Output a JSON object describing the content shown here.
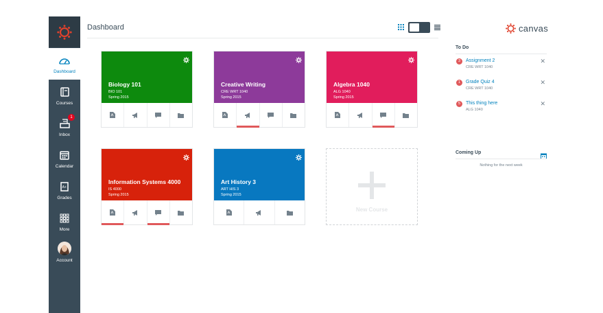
{
  "app": {
    "brand_name": "canvas",
    "accent": "#0081bd",
    "nav_bg": "#394b58"
  },
  "header": {
    "title": "Dashboard",
    "view_icons": [
      "grid-icon",
      "toggle-switch",
      "list-icon"
    ]
  },
  "global_nav": {
    "items": [
      {
        "key": "dashboard",
        "label": "Dashboard",
        "icon": "dashboard-icon",
        "active": true
      },
      {
        "key": "courses",
        "label": "Courses",
        "icon": "courses-icon"
      },
      {
        "key": "inbox",
        "label": "Inbox",
        "icon": "inbox-icon",
        "badge": "1"
      },
      {
        "key": "calendar",
        "label": "Calendar",
        "icon": "calendar-icon"
      },
      {
        "key": "grades",
        "label": "Grades",
        "icon": "grades-icon"
      },
      {
        "key": "more",
        "label": "More",
        "icon": "more-icon"
      },
      {
        "key": "account",
        "label": "Account",
        "icon": "avatar"
      }
    ]
  },
  "cards": [
    {
      "title": "Biology 101",
      "code": "BIO 101",
      "term": "Spring 2015",
      "color": "#0d8a0d"
    },
    {
      "title": "Creative Writing",
      "code": "CRE WRT 1040",
      "term": "Spring 2015",
      "color": "#8d3a9a"
    },
    {
      "title": "Algebra 1040",
      "code": "ALG 1040",
      "term": "Spring 2015",
      "color": "#e11d5c"
    },
    {
      "title": "Information Systems 4000",
      "code": "IS 4000",
      "term": "Spring 2015",
      "color": "#d7220b"
    },
    {
      "title": "Art History 3",
      "code": "ART HIS 3",
      "term": "Spring 2015",
      "color": "#0878c0"
    }
  ],
  "new_course": {
    "label": "New Course"
  },
  "todo": {
    "heading": "To Do",
    "items": [
      {
        "count": "3",
        "title": "Assignment 2",
        "course": "CRE WRT 1040"
      },
      {
        "count": "1",
        "title": "Grade Quiz 4",
        "course": "CRE WRT 1040"
      },
      {
        "count": "5",
        "title": "This thing here",
        "course": "ALG 1040"
      }
    ]
  },
  "coming_up": {
    "heading": "Coming Up",
    "empty_text": "Nothing for the next week"
  }
}
